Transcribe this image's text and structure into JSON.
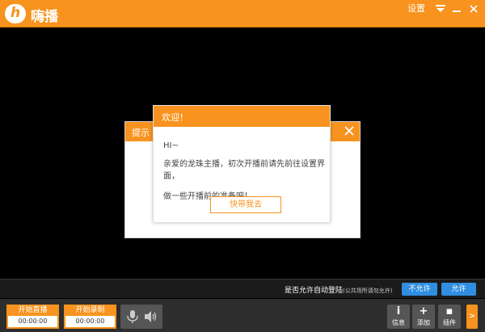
{
  "app": {
    "logo_text": "h",
    "title": "嗨播"
  },
  "titlebar": {
    "settings_label": "设置"
  },
  "dialog_back": {
    "title": "提示"
  },
  "dialog_front": {
    "title": "欢迎！",
    "greeting": "HI~",
    "line1": "亲爱的龙珠主播，初次开播前请先前往设置界面，",
    "line2": "做一些开播前的准备吧！",
    "button_label": "快带我去"
  },
  "notice": {
    "text": "是否允许自动登陆",
    "sub_text": "(公共场所请勿允许)",
    "deny_label": "不允许",
    "allow_label": "允许"
  },
  "controls": {
    "live": {
      "label": "开始直播",
      "time": "00:00:00"
    },
    "record": {
      "label": "开始录制",
      "time": "00:00:00"
    }
  },
  "tools": {
    "info": {
      "icon": "i",
      "label": "信息"
    },
    "add": {
      "icon": "+",
      "label": "添加"
    },
    "plugin": {
      "icon": "▪",
      "label": "插件"
    },
    "expand": ">"
  },
  "colors": {
    "accent": "#f7931e",
    "button_blue": "#2f8ee0"
  }
}
